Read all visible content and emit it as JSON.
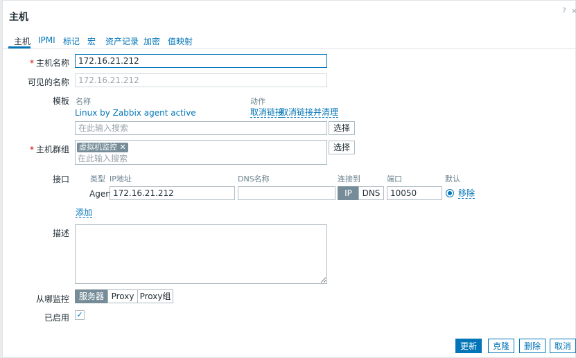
{
  "dialog": {
    "title": "主机",
    "help_label": "?",
    "close_label": "×"
  },
  "tabs": [
    {
      "label": "主机"
    },
    {
      "label": "IPMI"
    },
    {
      "label": "标记"
    },
    {
      "label": "宏"
    },
    {
      "label": "资产记录"
    },
    {
      "label": "加密"
    },
    {
      "label": "值映射"
    }
  ],
  "form": {
    "hostname": {
      "label": "主机名称",
      "required": "*",
      "value": "172.16.21.212"
    },
    "visible_name": {
      "label": "可见的名称",
      "placeholder": "172.16.21.212"
    },
    "templates": {
      "label": "模板",
      "col_name": "名称",
      "col_action": "动作",
      "items": [
        {
          "name": "Linux by Zabbix agent active",
          "unlink": "取消链接",
          "unlink_clear": "取消链接并清理"
        }
      ],
      "search_placeholder": "在此输入搜索",
      "select_label": "选择"
    },
    "host_groups": {
      "label": "主机群组",
      "required": "*",
      "tags": [
        {
          "name": "虚拟机监控",
          "remove": "✕"
        }
      ],
      "search_placeholder": "在此输入搜索",
      "select_label": "选择"
    },
    "interfaces": {
      "label": "接口",
      "headers": {
        "type": "类型",
        "ip": "IP地址",
        "dns": "DNS名称",
        "connect": "连接到",
        "port": "端口",
        "default": "默认"
      },
      "rows": [
        {
          "type": "Agent",
          "ip": "172.16.21.212",
          "dns": "",
          "connect_ip": "IP",
          "connect_dns": "DNS",
          "port": "10050",
          "remove": "移除"
        }
      ],
      "add_label": "添加"
    },
    "description": {
      "label": "描述",
      "value": ""
    },
    "monitored_by": {
      "label": "从哪监控",
      "options": [
        "服务器",
        "Proxy",
        "Proxy组"
      ],
      "selected": "服务器"
    },
    "enabled": {
      "label": "已启用",
      "checked": true,
      "mark": "✓"
    }
  },
  "footer": {
    "update": "更新",
    "clone": "克隆",
    "delete": "删除",
    "cancel": "取消"
  },
  "colors": {
    "accent": "#0275b8",
    "tag": "#768d99",
    "required": "#d40000"
  }
}
